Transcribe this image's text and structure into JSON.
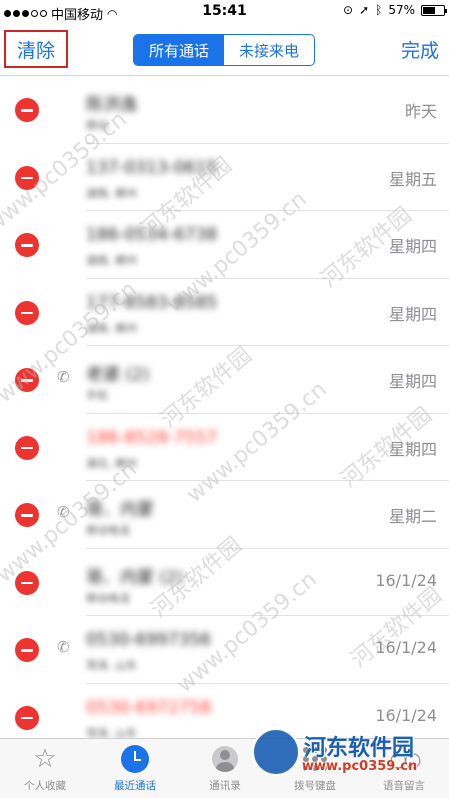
{
  "status_bar": {
    "carrier": "中国移动",
    "time": "15:41",
    "battery": "57%"
  },
  "nav": {
    "clear_label": "清除",
    "segments": [
      "所有通话",
      "未接来电"
    ],
    "active_segment": 0,
    "done_label": "完成"
  },
  "calls": [
    {
      "name": "陈洪逸",
      "sub": "移动",
      "date": "昨天",
      "missed": false,
      "icon": ""
    },
    {
      "name": "137-0313-0615",
      "sub": "湖南, 郴州",
      "date": "星期五",
      "missed": false,
      "icon": ""
    },
    {
      "name": "186-0534-6738",
      "sub": "湖南, 郴州",
      "date": "星期四",
      "missed": false,
      "icon": ""
    },
    {
      "name": "177-8583-8585",
      "sub": "湖南, 郴州",
      "date": "星期四",
      "missed": false,
      "icon": ""
    },
    {
      "name": "老婆 (2)",
      "sub": "手机",
      "date": "星期四",
      "missed": false,
      "icon": "phone-outgoing-icon"
    },
    {
      "name": "186-8528-7557",
      "sub": "湖北, 郴州",
      "date": "星期四",
      "missed": true,
      "icon": ""
    },
    {
      "name": "哥、内蒙",
      "sub": "移动电话",
      "date": "星期二",
      "missed": false,
      "icon": "phone-outgoing-icon"
    },
    {
      "name": "哥、内蒙 (2)",
      "sub": "移动电话",
      "date": "16/1/24",
      "missed": false,
      "icon": ""
    },
    {
      "name": "0530-6997356",
      "sub": "菏泽, 山东",
      "date": "16/1/24",
      "missed": false,
      "icon": "phone-outgoing-icon"
    },
    {
      "name": "0530-6972758",
      "sub": "菏泽, 山东",
      "date": "16/1/24",
      "missed": true,
      "icon": ""
    }
  ],
  "tabs": [
    {
      "label": "个人收藏",
      "icon": "star-icon"
    },
    {
      "label": "最近通话",
      "icon": "clock-icon"
    },
    {
      "label": "通讯录",
      "icon": "contacts-icon"
    },
    {
      "label": "拨号键盘",
      "icon": "keypad-icon"
    },
    {
      "label": "语音留言",
      "icon": "voicemail-icon"
    }
  ],
  "active_tab": 1,
  "watermark": {
    "site": "河东软件园",
    "url": "www.pc0359.cn"
  },
  "colors": {
    "accent": "#1a73e8",
    "delete": "#ee3431",
    "missed": "#ff3b30",
    "highlight_box": "#c9252b"
  }
}
